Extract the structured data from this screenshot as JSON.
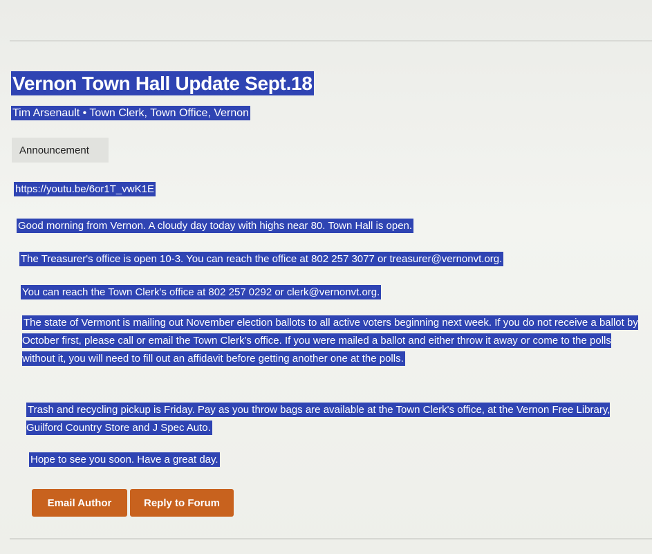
{
  "post": {
    "title": "Vernon Town Hall Update Sept.18",
    "author_line": "Tim Arsenault • Town Clerk, Town Office, Vernon",
    "tag": "Announcement",
    "link": "https://youtu.be/6or1T_vwK1E",
    "paragraphs": [
      "Good morning from Vernon. A cloudy day today with highs near 80. Town Hall is open.",
      "The Treasurer's office is open 10-3. You can reach the office at 802 257 3077 or treasurer@vernonvt.org.",
      "You can reach the Town Clerk's office at 802 257 0292 or clerk@vernonvt.org.",
      "The state of Vermont is mailing out November election ballots to all active voters beginning next week. If you do not receive a ballot by October first, please call or email the Town Clerk's office. If you were mailed a ballot and either throw it away or come to the polls without it, you will need to fill out an affidavit before getting another one at the polls.",
      "Trash and recycling pickup is Friday. Pay as you throw bags are available at the Town Clerk's office, at the Vernon Free Library, Guilford Country Store and J Spec Auto.",
      "Hope to see you soon. Have a great day."
    ]
  },
  "actions": {
    "email_author": "Email Author",
    "reply_to_forum": "Reply to Forum"
  },
  "colors": {
    "selection": "#2f44b3",
    "button": "#c8621e",
    "tag_bg": "#e1e2de",
    "page_bg": "#f2f2ee"
  }
}
